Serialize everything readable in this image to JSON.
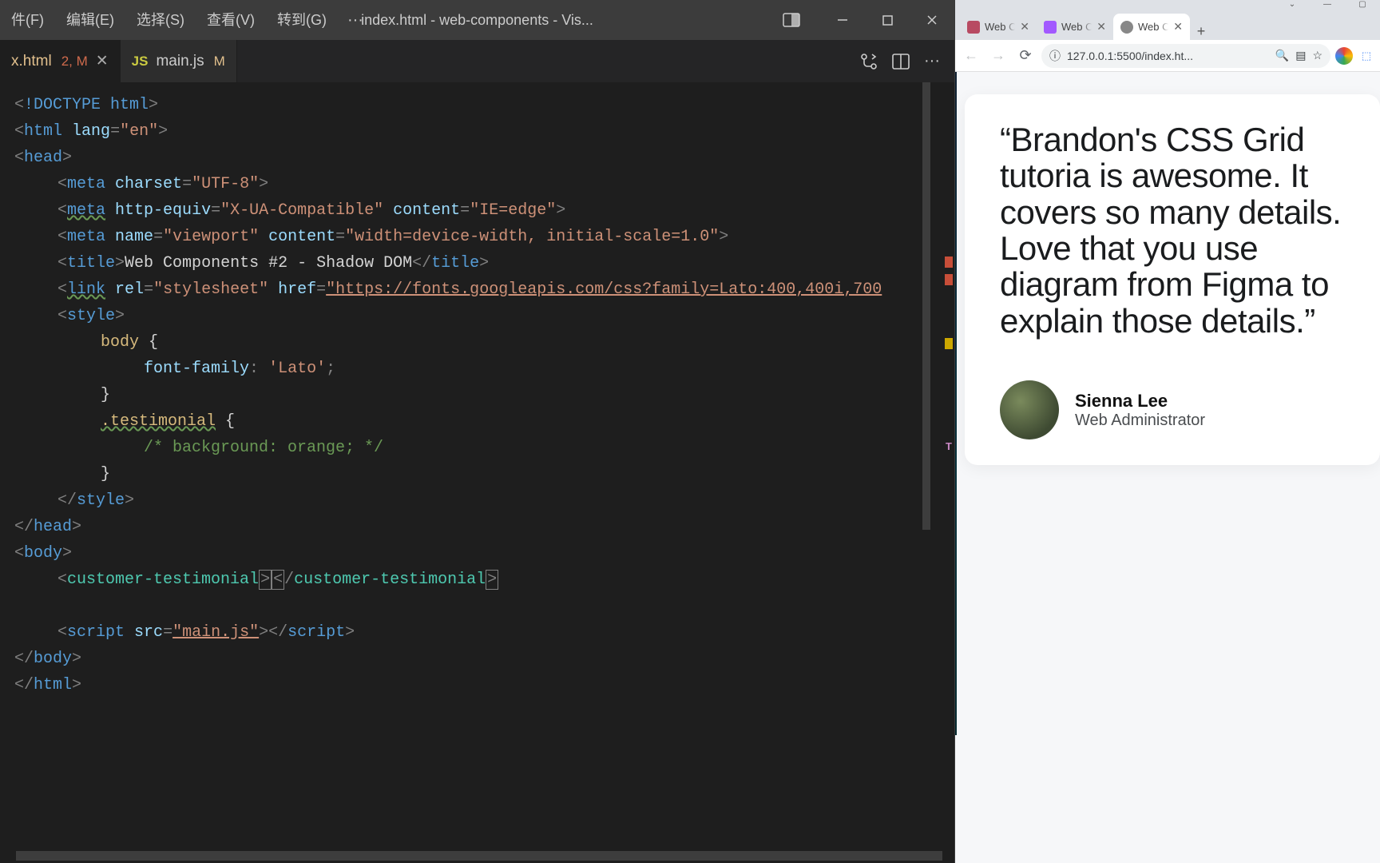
{
  "vscode": {
    "menu": [
      "件(F)",
      "编辑(E)",
      "选择(S)",
      "查看(V)",
      "转到(G)"
    ],
    "window_title": "index.html - web-components - Vis...",
    "tabs": [
      {
        "icon": "html",
        "label": "x.html",
        "badge": "2, M",
        "active": true
      },
      {
        "icon": "js",
        "icon_text": "JS",
        "label": "main.js",
        "badge": "M",
        "active": false
      }
    ],
    "code": {
      "l1_tag": "!DOCTYPE html",
      "l2_tag": "html",
      "l2_attr": "lang",
      "l2_val": "\"en\"",
      "l3_tag": "head",
      "l4_tag": "meta",
      "l4_a": "charset",
      "l4_v": "\"UTF-8\"",
      "l5_tag": "meta",
      "l5_a1": "http-equiv",
      "l5_v1": "\"X-UA-Compatible\"",
      "l5_a2": "content",
      "l5_v2": "\"IE=edge\"",
      "l6_tag": "meta",
      "l6_a1": "name",
      "l6_v1": "\"viewport\"",
      "l6_a2": "content",
      "l6_v2": "\"width=device-width, initial-scale=1.0\"",
      "l7_open": "title",
      "l7_text": "Web Components #2 - Shadow DOM",
      "l7_close": "title",
      "l8_tag": "link",
      "l8_a1": "rel",
      "l8_v1": "\"stylesheet\"",
      "l8_a2": "href",
      "l8_v2": "\"https://fonts.googleapis.com/css?family=Lato:400,400i,700",
      "l9_tag": "style",
      "l10_sel": "body",
      "l11_p": "font-family",
      "l11_v": "'Lato'",
      "l12_brace": "}",
      "l13_sel": ".testimonial",
      "l14_comment": "/* background: orange; */",
      "l15_brace": "}",
      "l16_close": "style",
      "l17_close": "head",
      "l18_tag": "body",
      "l19_tag": "customer-testimonial",
      "l20_tag": "script",
      "l20_a": "src",
      "l20_v": "\"main.js\"",
      "l21_close": "body",
      "l22_close": "html"
    }
  },
  "browser": {
    "tabs": [
      {
        "label": "Web C",
        "active": false,
        "fav": "#b84a62"
      },
      {
        "label": "Web C",
        "active": false,
        "fav": "#a259ff"
      },
      {
        "label": "Web C",
        "active": true,
        "fav": "#888"
      }
    ],
    "url": "127.0.0.1:5500/index.ht...",
    "testimonial": {
      "quote": "“Brandon's CSS Grid tutoria is awesome. It covers so many details. Love that you use diagram from Figma to explain those details.”",
      "name": "Sienna Lee",
      "role": "Web Administrator"
    }
  }
}
